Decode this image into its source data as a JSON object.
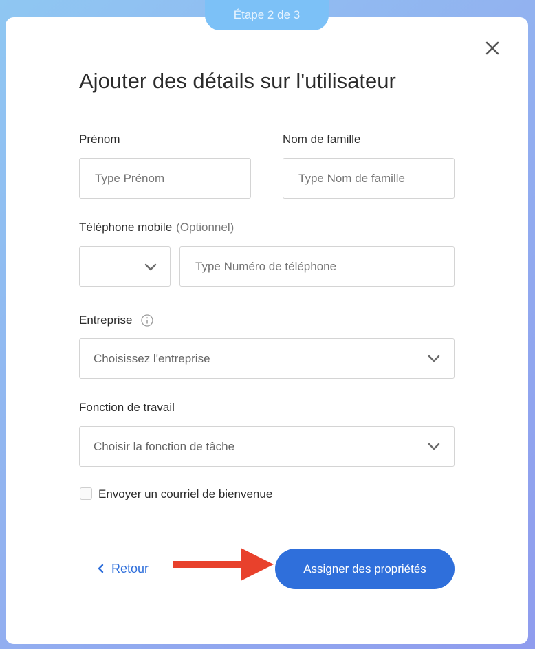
{
  "step_indicator": "Étape 2 de 3",
  "dialog": {
    "title": "Ajouter des détails sur l'utilisateur"
  },
  "form": {
    "first_name": {
      "label": "Prénom",
      "placeholder": "Type Prénom",
      "value": ""
    },
    "last_name": {
      "label": "Nom de famille",
      "placeholder": "Type Nom de famille",
      "value": ""
    },
    "phone": {
      "label": "Téléphone mobile",
      "optional": "(Optionnel)",
      "country_code": "",
      "placeholder": "Type Numéro de téléphone",
      "value": ""
    },
    "company": {
      "label": "Entreprise",
      "placeholder": "Choisissez l'entreprise"
    },
    "job_function": {
      "label": "Fonction de travail",
      "placeholder": "Choisir la fonction de tâche"
    },
    "welcome_email": {
      "label": "Envoyer un courriel de bienvenue",
      "checked": false
    }
  },
  "actions": {
    "back_label": "Retour",
    "primary_label": "Assigner des propriétés"
  },
  "icons": {
    "close": "close-icon",
    "chevron": "chevron-down-icon",
    "info": "info-icon",
    "back": "chevron-left-icon",
    "annotation": "red-arrow-icon"
  },
  "colors": {
    "primary": "#2f6fdb",
    "step_pill": "#7cc1f7",
    "annotation_arrow": "#e8412c"
  }
}
